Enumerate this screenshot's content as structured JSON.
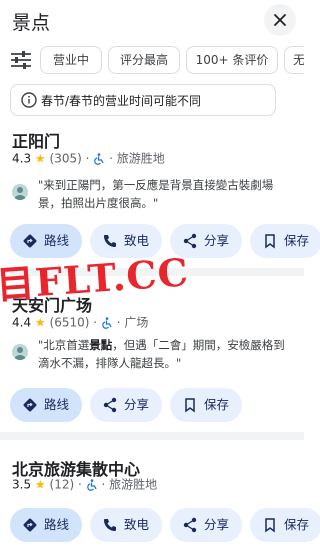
{
  "header": {
    "title": "景点"
  },
  "filters": {
    "chips": [
      "营业中",
      "评分最高",
      "100+ 条评价",
      "无"
    ]
  },
  "notice": {
    "text": "春节/春节的营业时间可能不同"
  },
  "places": [
    {
      "name": "正阳门",
      "rating": "4.3",
      "reviews": "(305)",
      "category": "旅游胜地",
      "review_before": "\"来到正陽門，第一反應是背景直接變古裝劇場景，拍照出片度很高。\"",
      "review_bold": "",
      "review_after": "",
      "actions": [
        "路线",
        "致电",
        "分享",
        "保存"
      ]
    },
    {
      "name": "天安门广场",
      "rating": "4.4",
      "reviews": "(6510)",
      "category": "广场",
      "review_before": "\"北京首選",
      "review_bold": "景點",
      "review_after": "，但遇「二會」期間，安檢嚴格到滴水不漏，排隊人龍超長。\"",
      "actions": [
        "路线",
        "分享",
        "保存"
      ]
    },
    {
      "name": "北京旅游集散中心",
      "rating": "3.5",
      "reviews": "(12)",
      "category": "旅游胜地",
      "actions": [
        "路线",
        "致电",
        "分享",
        "保存"
      ]
    }
  ],
  "watermark": "目FLT.CC",
  "colors": {
    "accent": "#1a73e8",
    "pill_bg": "#e8f0fe",
    "star": "#fbbc04",
    "watermark": "#e8131c"
  }
}
